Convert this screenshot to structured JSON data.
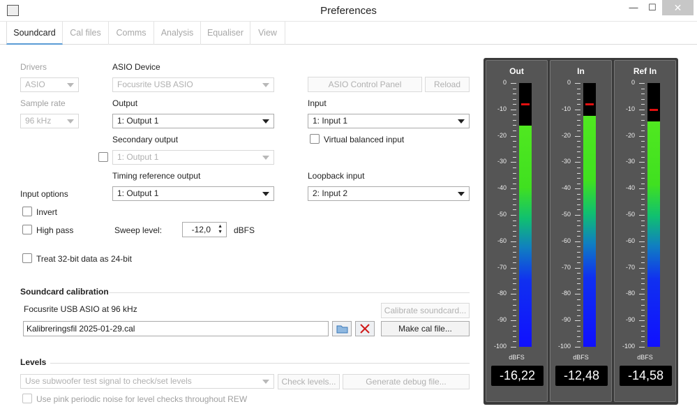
{
  "window": {
    "title": "Preferences",
    "minimize": "—",
    "maximize": "☐",
    "close": "✕"
  },
  "tabs": [
    "Soundcard",
    "Cal files",
    "Comms",
    "Analysis",
    "Equaliser",
    "View"
  ],
  "drivers": {
    "label": "Drivers",
    "value": "ASIO"
  },
  "sample_rate": {
    "label": "Sample rate",
    "value": "96 kHz"
  },
  "asio_device": {
    "label": "ASIO Device",
    "value": "Focusrite USB ASIO"
  },
  "asio_control_panel": "ASIO Control Panel",
  "reload": "Reload",
  "output": {
    "label": "Output",
    "value": "1: Output 1"
  },
  "input": {
    "label": "Input",
    "value": "1: Input 1"
  },
  "secondary_output": {
    "label": "Secondary output",
    "value": "1: Output 1"
  },
  "virtual_balanced": "Virtual balanced input",
  "timing_ref": {
    "label": "Timing reference output",
    "value": "1: Output 1"
  },
  "loopback": {
    "label": "Loopback input",
    "value": "2: Input 2"
  },
  "input_options": {
    "label": "Input options",
    "invert": "Invert",
    "high_pass": "High pass",
    "treat32": "Treat 32-bit data as 24-bit"
  },
  "sweep": {
    "label": "Sweep level:",
    "value": "-12,0",
    "unit": "dBFS"
  },
  "calibration": {
    "title": "Soundcard calibration",
    "device": "Focusrite USB ASIO at 96 kHz",
    "calibrate": "Calibrate soundcard...",
    "file": "Kalibreringsfil 2025-01-29.cal",
    "make": "Make cal file..."
  },
  "levels": {
    "title": "Levels",
    "signal": "Use subwoofer test signal to check/set levels",
    "check": "Check levels...",
    "debug": "Generate debug file...",
    "pink": "Use pink periodic noise for level checks throughout REW"
  },
  "meters": {
    "unit": "dBFS",
    "scale": [
      "0",
      "-10",
      "-20",
      "-30",
      "-40",
      "-50",
      "-60",
      "-70",
      "-80",
      "-90",
      "-100"
    ],
    "items": [
      {
        "name": "Out",
        "level": -16.22,
        "peak": -8,
        "readout": "-16,22"
      },
      {
        "name": "In",
        "level": -12.48,
        "peak": -8,
        "readout": "-12,48"
      },
      {
        "name": "Ref In",
        "level": -14.58,
        "peak": -10,
        "readout": "-14,58"
      }
    ]
  },
  "colors": {
    "accent": "#5a9bd5",
    "meter_bg": "#3a3a3a",
    "peak": "#e01010",
    "delete": "#d01818"
  }
}
